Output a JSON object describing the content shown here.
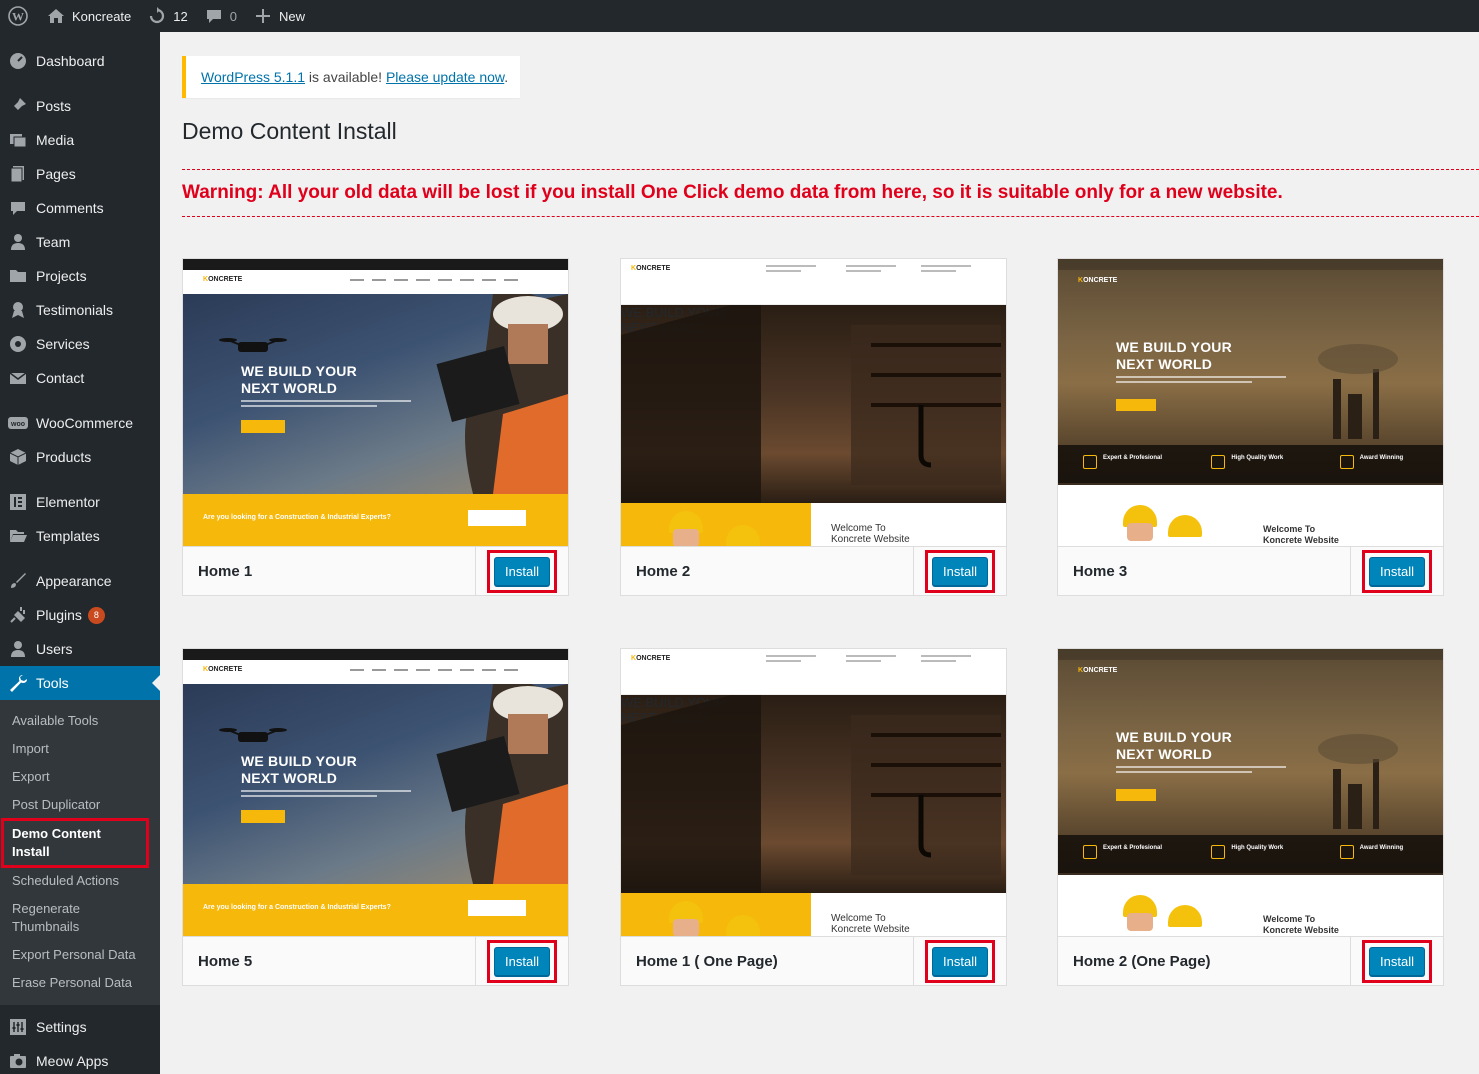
{
  "adminbar": {
    "site_name": "Koncreate",
    "updates_count": "12",
    "comments_count": "0",
    "new_label": "New"
  },
  "sidebar": {
    "items": [
      {
        "label": "Dashboard",
        "icon": "dashboard-icon"
      },
      {
        "label": "Posts",
        "icon": "pin-icon"
      },
      {
        "label": "Media",
        "icon": "media-icon"
      },
      {
        "label": "Pages",
        "icon": "pages-icon"
      },
      {
        "label": "Comments",
        "icon": "comment-icon"
      },
      {
        "label": "Team",
        "icon": "user-icon"
      },
      {
        "label": "Projects",
        "icon": "folder-icon"
      },
      {
        "label": "Testimonials",
        "icon": "award-icon"
      },
      {
        "label": "Services",
        "icon": "services-icon"
      },
      {
        "label": "Contact",
        "icon": "mail-icon"
      },
      {
        "label": "WooCommerce",
        "icon": "woo-icon"
      },
      {
        "label": "Products",
        "icon": "box-icon"
      },
      {
        "label": "Elementor",
        "icon": "elementor-icon"
      },
      {
        "label": "Templates",
        "icon": "folder-icon"
      },
      {
        "label": "Appearance",
        "icon": "brush-icon"
      },
      {
        "label": "Plugins",
        "icon": "plug-icon",
        "badge": "8"
      },
      {
        "label": "Users",
        "icon": "users-icon"
      },
      {
        "label": "Tools",
        "icon": "wrench-icon"
      },
      {
        "label": "Settings",
        "icon": "settings-icon"
      },
      {
        "label": "Meow Apps",
        "icon": "camera-icon"
      }
    ],
    "tools_submenu": [
      "Available Tools",
      "Import",
      "Export",
      "Post Duplicator",
      "Demo Content Install",
      "Scheduled Actions",
      "Regenerate Thumbnails",
      "Export Personal Data",
      "Erase Personal Data"
    ]
  },
  "notice": {
    "link1": "WordPress 5.1.1",
    "text": " is available! ",
    "link2": "Please update now",
    "end": "."
  },
  "page": {
    "title": "Demo Content Install",
    "warning": "Warning: All your old data will be lost if you install One Click demo data from here, so it is suitable only for a new website."
  },
  "demos": [
    {
      "name": "Home 1",
      "button": "Install"
    },
    {
      "name": "Home 2",
      "button": "Install"
    },
    {
      "name": "Home 3",
      "button": "Install"
    },
    {
      "name": "Home 5",
      "button": "Install"
    },
    {
      "name": "Home 1 ( One Page)",
      "button": "Install"
    },
    {
      "name": "Home 2 (One Page)",
      "button": "Install"
    }
  ],
  "screenshots": {
    "hero_headline_1": "WE BUILD YOUR",
    "hero_headline_2": "NEXT WORLD",
    "logo_prefix": "K",
    "logo_suffix": "ONCRETE",
    "strip_text": "Are you looking for a Construction & Industrial Experts?",
    "welcome_1": "Welcome To",
    "welcome_2": "Koncrete Website",
    "feature_1": "Expert & Profesional",
    "feature_2": "High Quality Work",
    "feature_3": "Award Winning"
  },
  "colors": {
    "admin_dark": "#23282d",
    "accent_blue": "#0073aa",
    "button_blue": "#0085ba",
    "warning_red": "#e0001b",
    "notice_yellow": "#ffb900",
    "brand_yellow": "#f6b80a"
  }
}
